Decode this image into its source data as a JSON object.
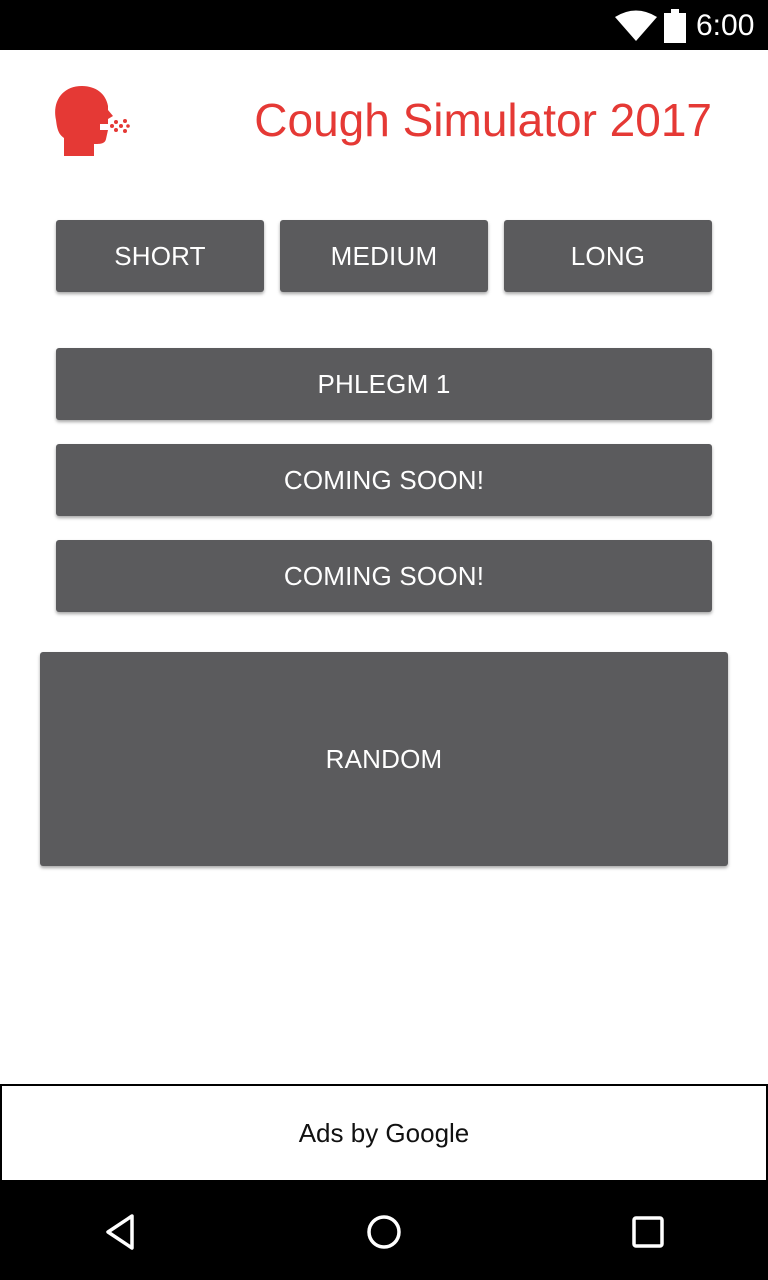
{
  "status_bar": {
    "time": "6:00",
    "icons": [
      "wifi-icon",
      "battery-icon"
    ]
  },
  "header": {
    "logo_icon": "coughing-head-icon",
    "title": "Cough Simulator 2017",
    "accent_color": "#e53935"
  },
  "buttons": {
    "short": "SHORT",
    "medium": "MEDIUM",
    "long": "LONG",
    "phlegm": "PHLEGM 1",
    "coming_soon_1": "COMING SOON!",
    "coming_soon_2": "COMING SOON!",
    "random": "RANDOM",
    "color": "#5b5b5d"
  },
  "ad": {
    "label": "Ads by Google"
  },
  "nav_bar": {
    "icons": [
      "back-icon",
      "home-icon",
      "recent-apps-icon"
    ]
  }
}
